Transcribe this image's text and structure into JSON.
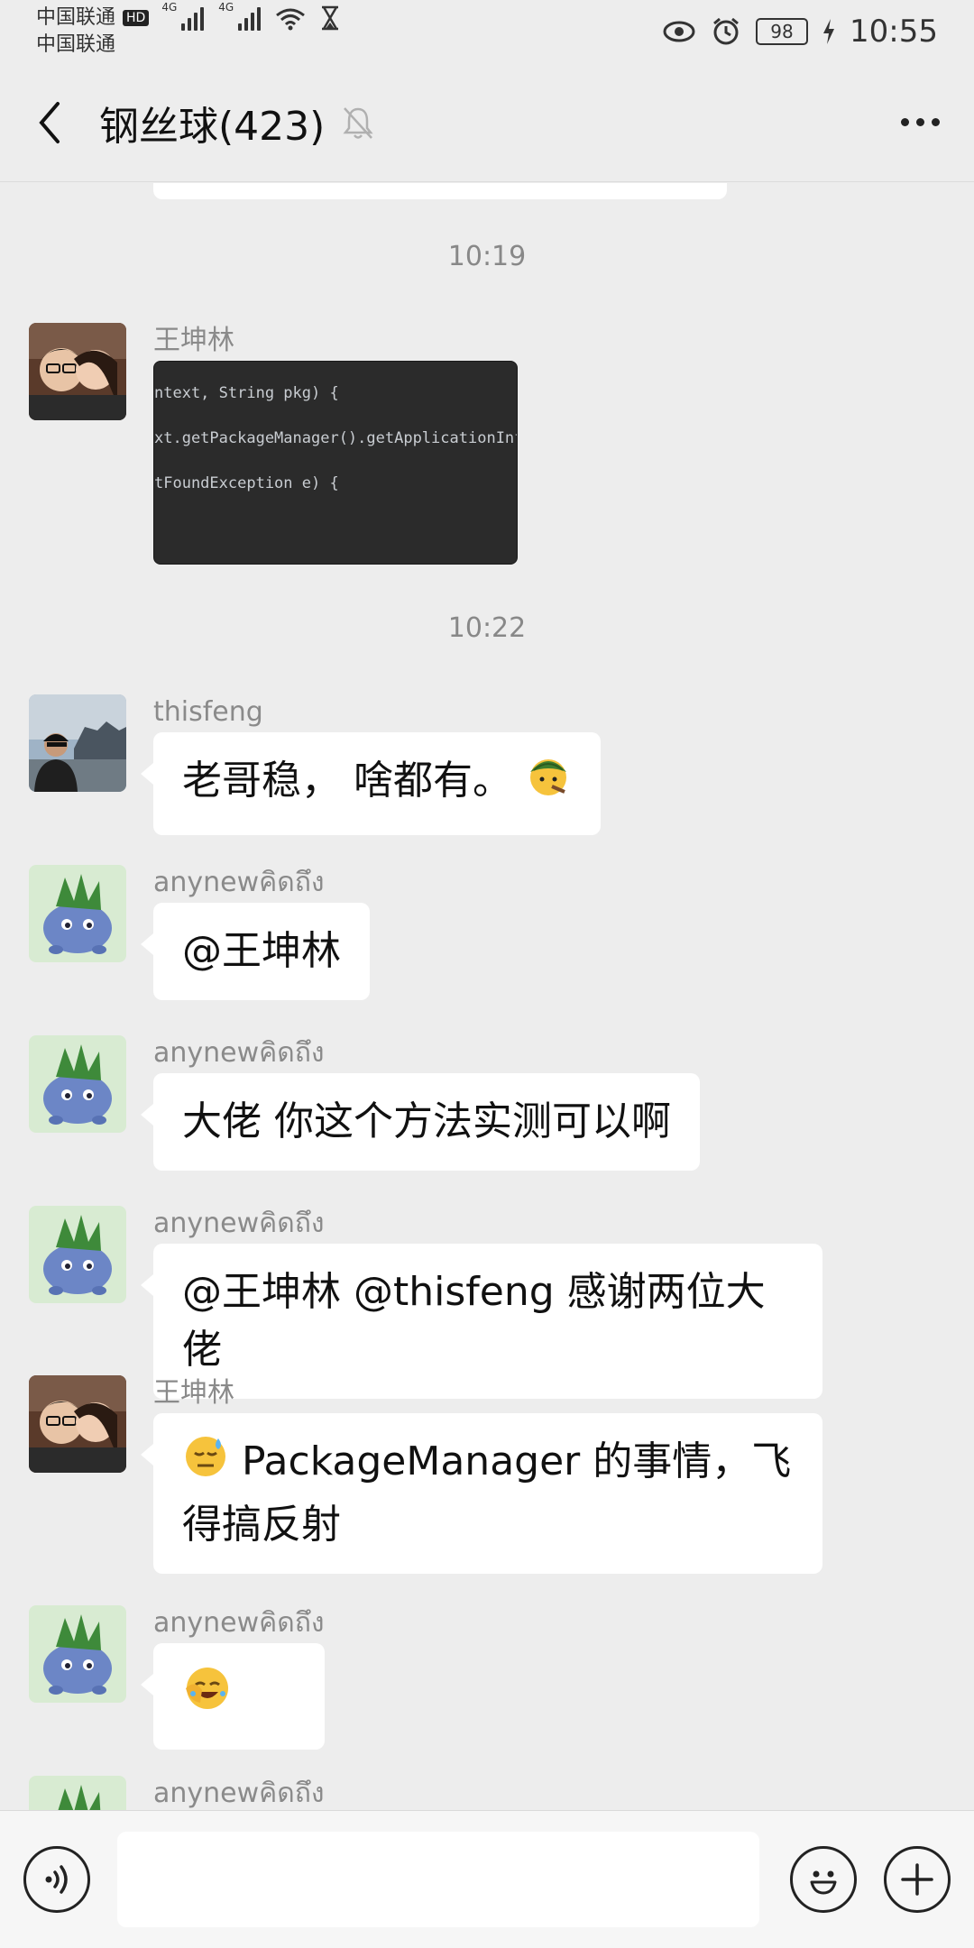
{
  "status_bar": {
    "carrier_1": "中国联通",
    "hd_label": "HD",
    "carrier_2": "中国联通",
    "network_1": "4G",
    "network_2": "4G",
    "battery": "98",
    "time": "10:55"
  },
  "header": {
    "title": "钢丝球(423)"
  },
  "chat": {
    "timestamps": [
      "10:19",
      "10:22"
    ],
    "code_snippet": [
      "ntext, String pkg) {",
      "xt.getPackageManager().getApplicationInfo(p",
      "tFoundException e) {"
    ],
    "messages": [
      {
        "sender": "王坤林",
        "type": "image"
      },
      {
        "sender": "thisfeng",
        "text": "老哥稳， 啥都有。"
      },
      {
        "sender": "anynewคิดถึง",
        "text": "@王坤林"
      },
      {
        "sender": "anynewคิดถึง",
        "text": "大佬 你这个方法实测可以啊"
      },
      {
        "sender": "anynewคิดถึง",
        "text": "@王坤林 @thisfeng 感谢两位大佬"
      },
      {
        "sender": "王坤林",
        "text": "PackageManager 的事情，飞得搞反射"
      },
      {
        "sender": "anynewคิดถึง",
        "text": ""
      },
      {
        "sender": "anynewคิดถึง",
        "text": ""
      }
    ]
  },
  "input": {
    "value": ""
  },
  "colors": {
    "background": "#EDEDED",
    "bubble": "#FFFFFF",
    "input_bar": "#F6F6F6"
  }
}
